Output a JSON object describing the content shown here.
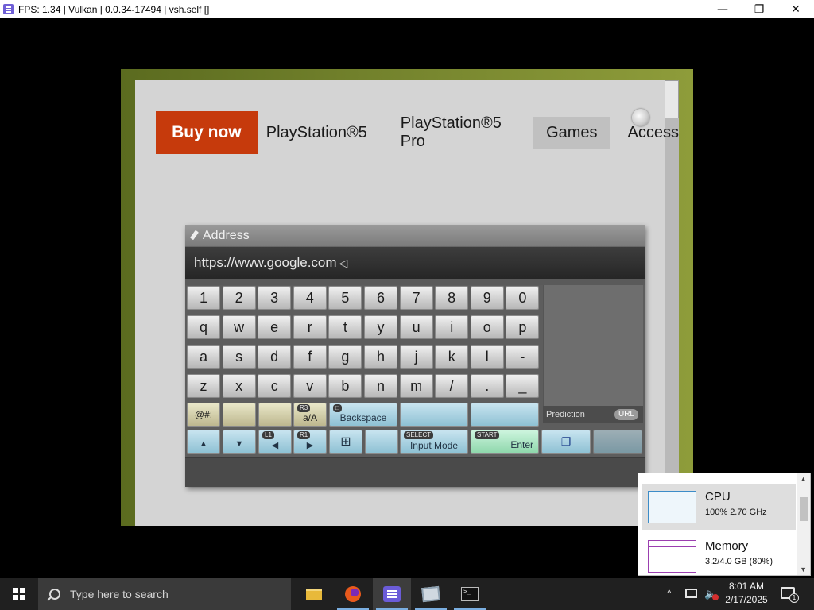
{
  "window": {
    "title": "FPS: 1.34 | Vulkan | 0.0.34-17494 | vsh.self []",
    "minimize_glyph": "—",
    "maximize_glyph": "❐",
    "close_glyph": "✕"
  },
  "web": {
    "buy_now": "Buy now",
    "nav_links": [
      "PlayStation®5",
      "PlayStation®5 Pro",
      "Games",
      "Access"
    ]
  },
  "osk": {
    "header": "Address",
    "input_value": "https://www.google.com",
    "caret_glyph": "◁",
    "rows": [
      [
        "1",
        "2",
        "3",
        "4",
        "5",
        "6",
        "7",
        "8",
        "9",
        "0"
      ],
      [
        "q",
        "w",
        "e",
        "r",
        "t",
        "y",
        "u",
        "i",
        "o",
        "p"
      ],
      [
        "a",
        "s",
        "d",
        "f",
        "g",
        "h",
        "j",
        "k",
        "l",
        "-"
      ],
      [
        "z",
        "x",
        "c",
        "v",
        "b",
        "n",
        "m",
        "/",
        ".",
        "_"
      ]
    ],
    "special": {
      "symbols": "@#:",
      "case_badge": "R3",
      "case_label": "a/A",
      "backspace_badge": "□",
      "backspace": "Backspace",
      "up_glyph": "▲",
      "down_glyph": "▼",
      "l1_badge": "L1",
      "left_glyph": "◀",
      "r1_badge": "R1",
      "right_glyph": "▶",
      "grid_glyph": "⊞",
      "select_badge": "SELECT",
      "input_mode": "Input Mode",
      "start_badge": "START",
      "enter": "Enter",
      "copy_glyph": "❐",
      "prediction": "Prediction",
      "url_badge": "URL"
    }
  },
  "task_manager": {
    "cpu": {
      "name": "CPU",
      "value": "100%  2.70 GHz"
    },
    "memory": {
      "name": "Memory",
      "value": "3.2/4.0 GB (80%)"
    },
    "scroll_up": "▲",
    "scroll_down": "▼"
  },
  "taskbar": {
    "search_placeholder": "Type here to search",
    "terminal_glyph": ">_",
    "tray_chevron": "^",
    "volume_glyph": "🔈",
    "clock_time": "8:01 AM",
    "clock_date": "2/17/2025",
    "notification_count": "1"
  },
  "colors": {
    "buy_now": "#c63a0c",
    "taskbar": "#202020",
    "cpu_graph": "#3c8cc8",
    "memory_graph": "#9b3fb0"
  }
}
